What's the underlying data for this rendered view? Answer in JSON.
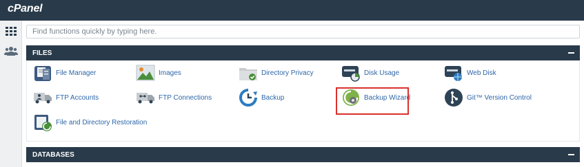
{
  "header": {
    "logo_text": "cPanel"
  },
  "sidebar": {
    "items": [
      {
        "icon": "grid-icon"
      },
      {
        "icon": "users-icon"
      }
    ]
  },
  "search": {
    "placeholder": "Find functions quickly by typing here.",
    "value": ""
  },
  "files_section": {
    "title": "FILES",
    "items": [
      {
        "label": "File Manager",
        "icon": "file-manager-icon"
      },
      {
        "label": "Images",
        "icon": "images-icon"
      },
      {
        "label": "Directory Privacy",
        "icon": "directory-privacy-icon"
      },
      {
        "label": "Disk Usage",
        "icon": "disk-usage-icon"
      },
      {
        "label": "Web Disk",
        "icon": "web-disk-icon"
      },
      {
        "label": "FTP Accounts",
        "icon": "ftp-accounts-icon"
      },
      {
        "label": "FTP Connections",
        "icon": "ftp-connections-icon"
      },
      {
        "label": "Backup",
        "icon": "backup-icon"
      },
      {
        "label": "Backup Wizard",
        "icon": "backup-wizard-icon",
        "highlighted": true
      },
      {
        "label": "Git™ Version Control",
        "icon": "git-icon"
      },
      {
        "label": "File and Directory Restoration",
        "icon": "file-restoration-icon"
      }
    ]
  },
  "databases_section": {
    "title": "DATABASES"
  },
  "colors": {
    "header_bg": "#293a4a",
    "link": "#2e66a8",
    "highlight": "#d9302c"
  }
}
